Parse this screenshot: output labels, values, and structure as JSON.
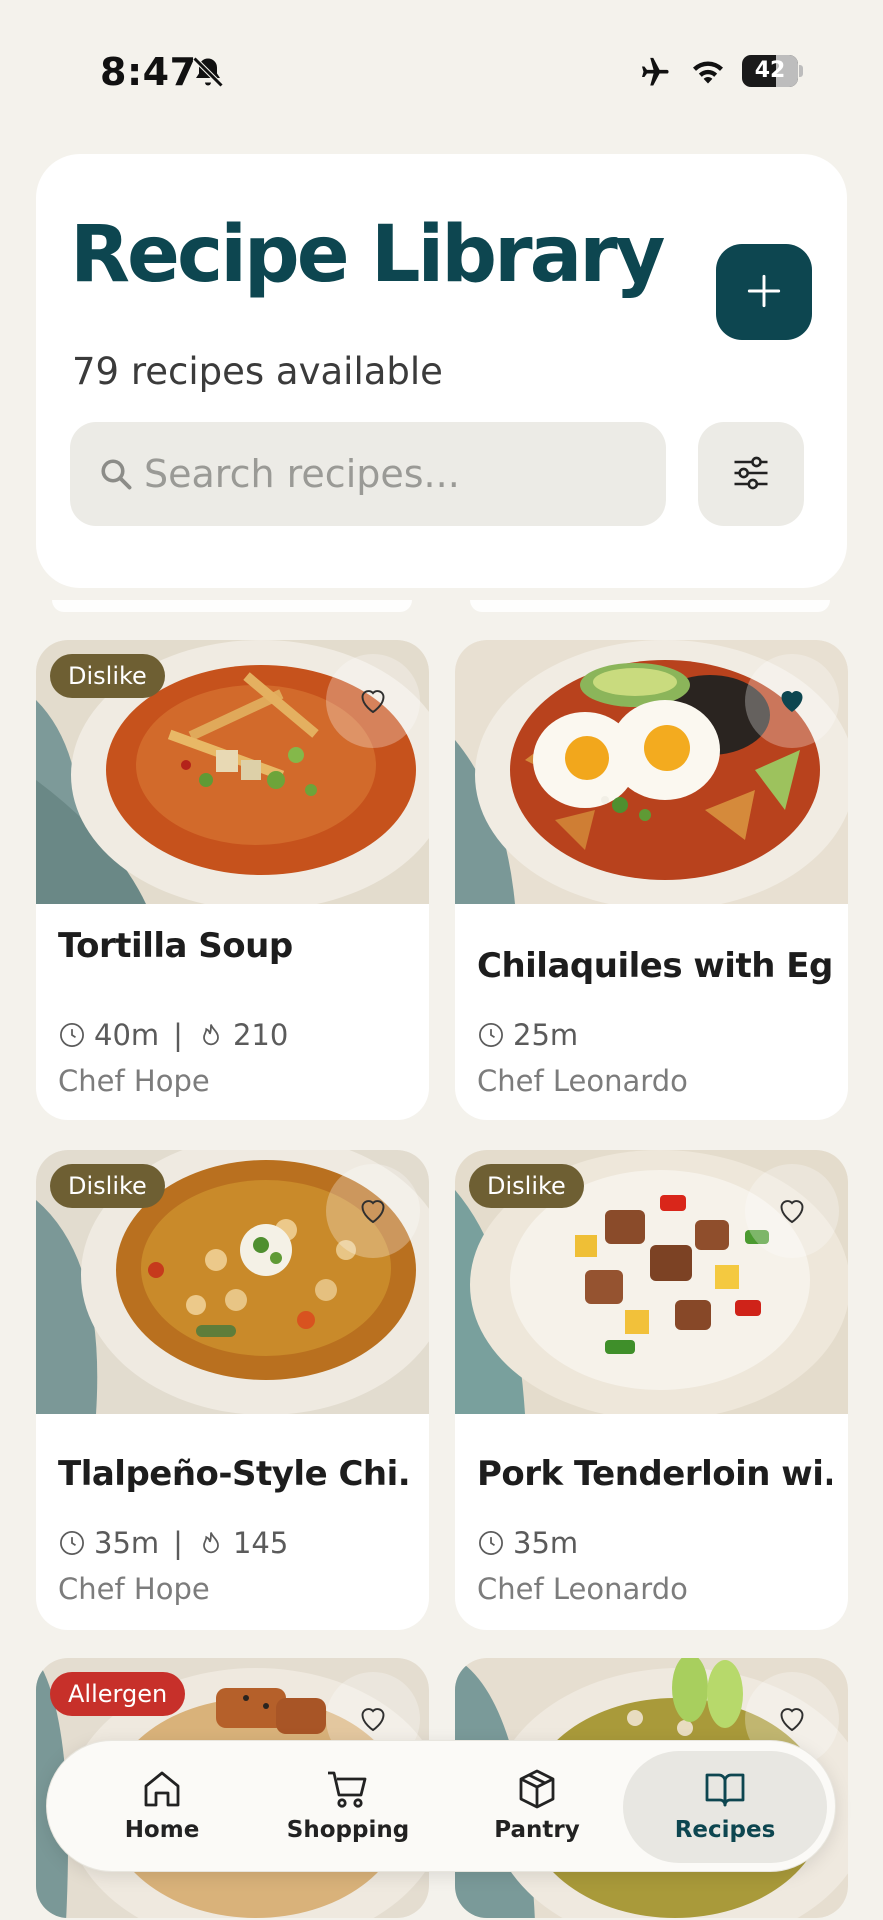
{
  "status_bar": {
    "time": "8:47",
    "battery": "42",
    "icons": [
      "bell-slash-icon",
      "airplane-icon",
      "wifi-icon",
      "battery-icon"
    ]
  },
  "header": {
    "title": "Recipe Library",
    "subtitle": "79 recipes available",
    "add_icon": "plus-icon",
    "filter_icon": "sliders-icon"
  },
  "search": {
    "placeholder": "Search recipes..."
  },
  "colors": {
    "brand": "#0d4650",
    "background": "#f4f2ec",
    "dislike_badge": "#6e5f33",
    "allergen_badge": "#c7302a"
  },
  "recipes": [
    {
      "title": "Tortilla Soup",
      "time": "40m",
      "calories": "210",
      "chef": "Chef Hope",
      "badge": "Dislike",
      "favorite": false
    },
    {
      "title": "Chilaquiles with Eg...",
      "time": "25m",
      "calories": "",
      "chef": "Chef Leonardo",
      "badge": "",
      "favorite": true
    },
    {
      "title": "Tlalpeño-Style Chi...",
      "time": "35m",
      "calories": "145",
      "chef": "Chef Hope",
      "badge": "Dislike",
      "favorite": false
    },
    {
      "title": "Pork Tenderloin wi...",
      "time": "35m",
      "calories": "",
      "chef": "Chef Leonardo",
      "badge": "Dislike",
      "favorite": false
    },
    {
      "title": "",
      "time": "",
      "calories": "",
      "chef": "",
      "badge": "Allergen",
      "favorite": false
    },
    {
      "title": "",
      "time": "",
      "calories": "",
      "chef": "",
      "badge": "",
      "favorite": false
    }
  ],
  "nav": {
    "items": [
      {
        "label": "Home",
        "icon": "home-icon"
      },
      {
        "label": "Shopping",
        "icon": "cart-icon"
      },
      {
        "label": "Pantry",
        "icon": "box-icon"
      },
      {
        "label": "Recipes",
        "icon": "book-icon"
      }
    ],
    "active": "Recipes"
  }
}
